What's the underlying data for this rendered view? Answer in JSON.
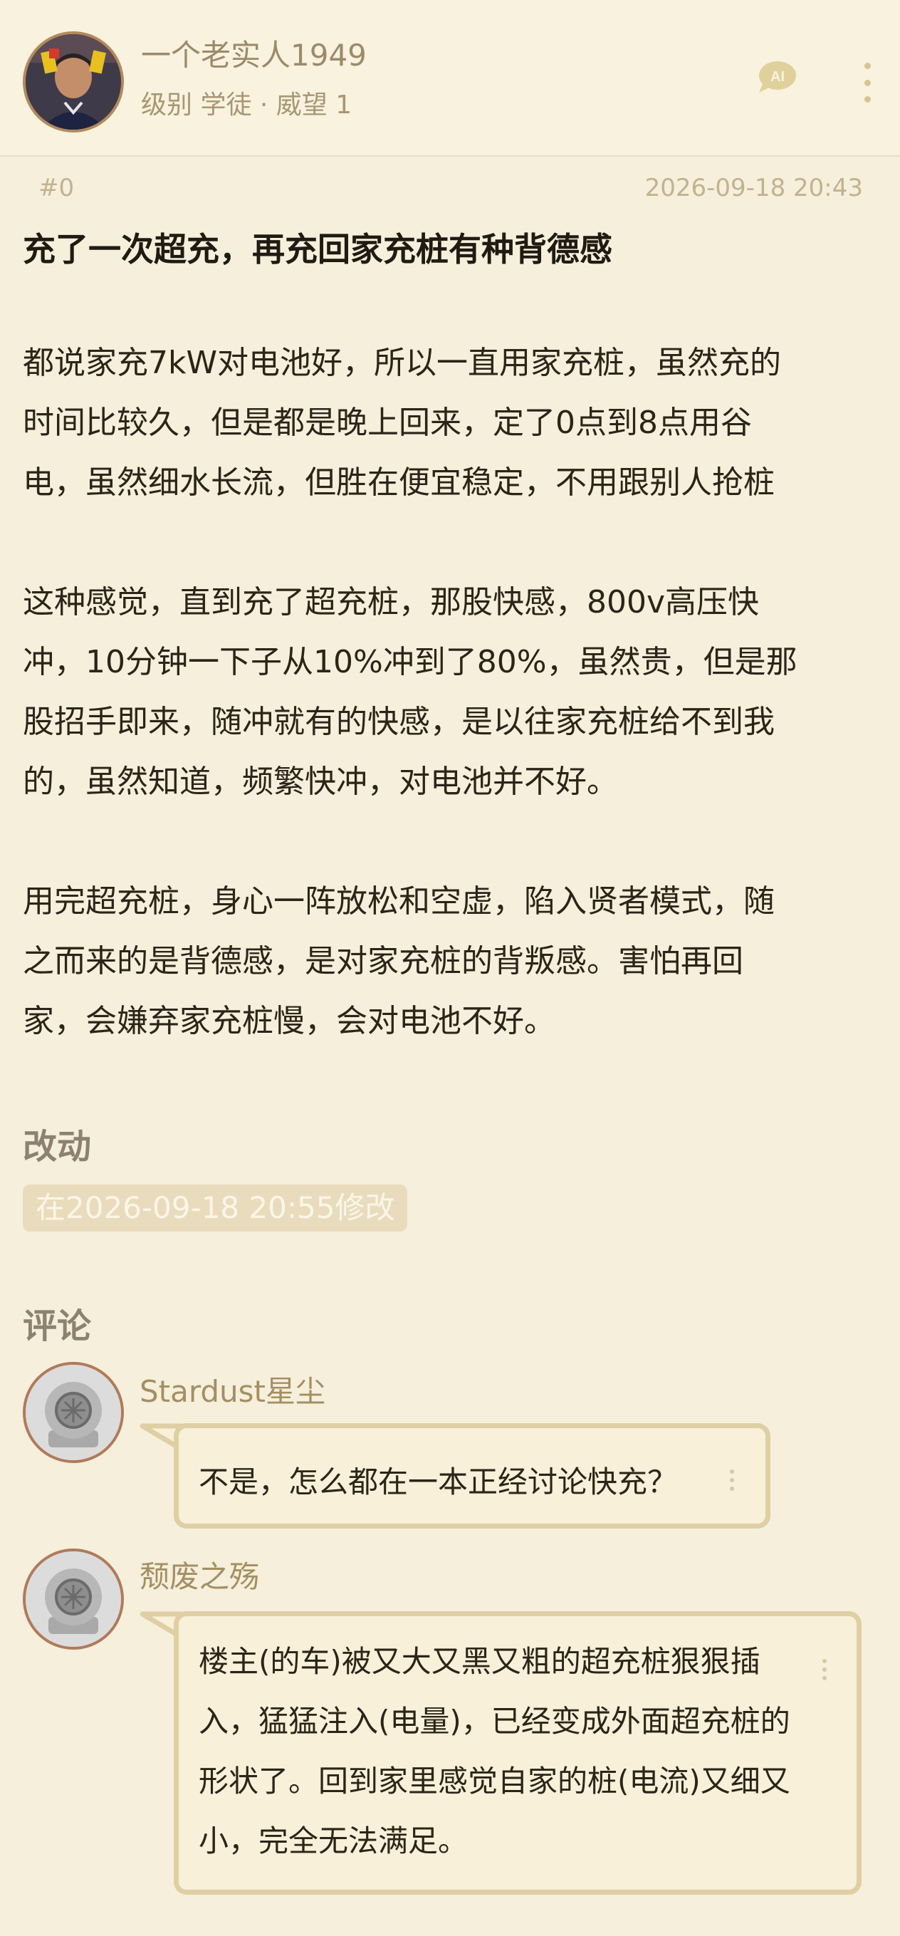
{
  "author": {
    "name": "一个老实人1949",
    "meta": "级别 学徒 · 威望 1"
  },
  "post": {
    "floor": "#0",
    "time": "2026-09-18 20:43",
    "title": "充了一次超充，再充回家充桩有种背德感",
    "paragraphs": [
      "都说家充7kW对电池好，所以一直用家充桩，虽然充的\n时间比较久，但是都是晚上回来，定了0点到8点用谷\n电，虽然细水长流，但胜在便宜稳定，不用跟别人抢桩",
      "这种感觉，直到充了超充桩，那股快感，800v高压快\n冲，10分钟一下子从10%冲到了80%，虽然贵，但是那\n股招手即来，随冲就有的快感，是以往家充桩给不到我\n的，虽然知道，频繁快冲，对电池并不好。",
      "用完超充桩，身心一阵放松和空虚，陷入贤者模式，随\n之而来的是背德感，是对家充桩的背叛感。害怕再回\n家，会嫌弃家充桩慢，会对电池不好。"
    ]
  },
  "edits": {
    "heading": "改动",
    "badge": "在2026-09-18 20:55修改"
  },
  "comments": {
    "heading": "评论",
    "items": [
      {
        "name": "Stardust星尘",
        "text": "不是，怎么都在一本正经讨论快充？"
      },
      {
        "name": "颓废之殇",
        "text": "楼主(的车)被又大又黑又粗的超充桩狠狠插\n入，猛猛注入(电量)，已经变成外面超充桩的\n形状了。回到家里感觉自家的桩(电流)又细又\n小，完全无法满足。"
      }
    ]
  },
  "icons": {
    "ai": "ai-icon",
    "more": "more-vertical-icon",
    "default_avatar": "diving-helmet-avatar-icon"
  },
  "colors": {
    "background": "#f6efdb",
    "accent": "#d6c495",
    "bubble_border": "#dfcfa5"
  }
}
